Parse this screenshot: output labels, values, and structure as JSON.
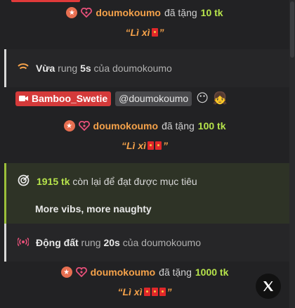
{
  "gifts": [
    {
      "user": "doumokoumo",
      "verb": "đã tặng",
      "amount": "10 tk",
      "message": "“Lì xì",
      "message_end": "”",
      "envelopes": 1
    },
    {
      "user": "doumokoumo",
      "verb": "đã tặng",
      "amount": "100 tk",
      "message": "“Lì xì",
      "message_end": "”",
      "envelopes": 2
    },
    {
      "user": "doumokoumo",
      "verb": "đã tặng",
      "amount": "1000 tk",
      "message": "“Lì xì",
      "message_end": "”",
      "envelopes": 3
    }
  ],
  "vibe1": {
    "bold": "Vừa",
    "mid": "rung",
    "dur": "5s",
    "tail": "của doumokoumo"
  },
  "tags": {
    "cam_label": "Bamboo_Swetie",
    "user_label": "@doumokoumo",
    "emoji1": "😶",
    "emoji2": "👧"
  },
  "goal": {
    "remaining": "1915 tk",
    "text": "còn lại để đạt được mục tiêu",
    "title": "More vibs, more naughty"
  },
  "vibe2": {
    "bold": "Động đất",
    "mid": "rung",
    "dur": "20s",
    "tail": "của doumokoumo"
  },
  "colors": {
    "accent_orange": "#f5a24a",
    "accent_green": "#b6e34b",
    "cam_red": "#d43a3a"
  }
}
